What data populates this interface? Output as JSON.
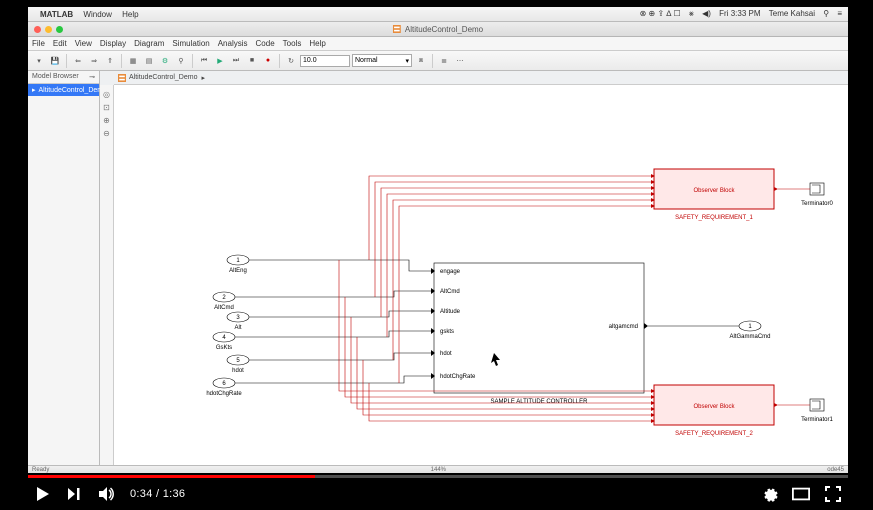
{
  "mac": {
    "app_name": "MATLAB",
    "menu": [
      "Window",
      "Help"
    ],
    "clock": "Fri 3:33 PM",
    "user": "Teme Kahsai"
  },
  "window": {
    "title": "AltitudeControl_Demo"
  },
  "app_menu": [
    "File",
    "Edit",
    "View",
    "Display",
    "Diagram",
    "Simulation",
    "Analysis",
    "Code",
    "Tools",
    "Help"
  ],
  "toolbar": {
    "stop_time": "10.0",
    "mode": "Normal"
  },
  "model_browser": {
    "title": "Model Browser",
    "item": "AltitudeControl_Demo"
  },
  "breadcrumb": {
    "root": "AltitudeControl_Demo"
  },
  "inports": [
    {
      "n": "1",
      "label": "AltEng"
    },
    {
      "n": "2",
      "label": "AltCmd"
    },
    {
      "n": "3",
      "label": "Alt"
    },
    {
      "n": "4",
      "label": "GsKts"
    },
    {
      "n": "5",
      "label": "hdot"
    },
    {
      "n": "6",
      "label": "hdotChgRate"
    }
  ],
  "controller": {
    "title": "SAMPLE ALTITUDE CONTROLLER",
    "in_ports": [
      "engage",
      "AltCmd",
      "Altitude",
      "gskts",
      "hdot",
      "hdotChgRate"
    ],
    "out_port": "altgamcmd"
  },
  "observers": {
    "title": "Observer Block",
    "safety1": "SAFETY_REQUIREMENT_1",
    "safety2": "SAFETY_REQUIREMENT_2",
    "term0": "Terminator0",
    "term1": "Terminator1"
  },
  "outport": {
    "n": "1",
    "label": "AltGammaCmd"
  },
  "status": {
    "ready": "Ready",
    "zoom": "144%",
    "mode": "ode45"
  },
  "player": {
    "current": "0:34",
    "duration": "1:36",
    "progress_pct": 35
  }
}
